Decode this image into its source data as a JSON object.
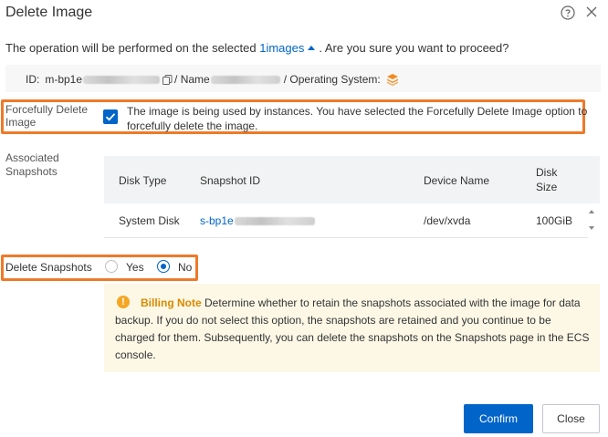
{
  "dialog": {
    "title": "Delete Image"
  },
  "intro": {
    "prefix": "The operation will be performed on the selected ",
    "images_link": "1images",
    "suffix": ". Are you sure you want to proceed?"
  },
  "info": {
    "id_label": "ID:",
    "id_prefix": "m-bp1e",
    "name_label": "/ Name",
    "os_label": "/ Operating System:"
  },
  "force_delete": {
    "label": "Forcefully Delete Image",
    "checked": true,
    "text": "The image is being used by instances. You have selected the Forcefully Delete Image option to forcefully delete the image."
  },
  "snapshots": {
    "label": "Associated Snapshots",
    "columns": [
      "Disk Type",
      "Snapshot ID",
      "Device Name",
      "Disk Size"
    ],
    "rows": [
      {
        "disk_type": "System Disk",
        "snapshot_id_prefix": "s-bp1e",
        "device_name": "/dev/xvda",
        "disk_size": "100GiB"
      }
    ]
  },
  "delete_snapshots": {
    "label": "Delete Snapshots",
    "options": [
      "Yes",
      "No"
    ],
    "selected": "No"
  },
  "billing_note": {
    "title": "Billing Note",
    "text": "Determine whether to retain the snapshots associated with the image for data backup. If you do not select this option, the snapshots are retained and you continue to be charged for them. Subsequently, you can delete the snapshots on the Snapshots page in the ECS console."
  },
  "footer": {
    "confirm": "Confirm",
    "close": "Close"
  },
  "colors": {
    "primary": "#0064c8",
    "highlight": "#ee7a2a",
    "note_bg": "#fdf8e6",
    "os_icon": "#f28b22"
  },
  "icons": [
    "help-icon",
    "close-icon",
    "copy-icon",
    "os-stack-icon",
    "caret-up-icon",
    "check-icon",
    "warning-icon"
  ]
}
